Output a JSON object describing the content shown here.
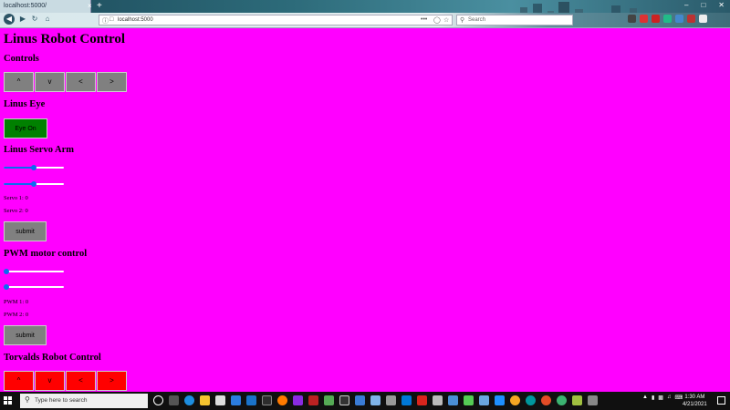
{
  "browser": {
    "tab_title": "localhost:5000/",
    "tab_close": "×",
    "new_tab": "+",
    "url": "localhost:5000",
    "search_placeholder": "Search",
    "menu_dots": "•••",
    "win_min": "–",
    "win_max": "□",
    "win_close": "✕"
  },
  "page": {
    "title": "Linus Robot Control",
    "controls_heading": "Controls",
    "controls_buttons": [
      "^",
      "v",
      "<",
      ">"
    ],
    "eye_heading": "Linus Eye",
    "eye_button": "Eye On",
    "servo_heading": "Linus Servo Arm",
    "servo1_value": 0.5,
    "servo2_value": 0.5,
    "servo1_label": "Servo 1: 0",
    "servo2_label": "Servo 2: 0",
    "servo_submit": "submit",
    "pwm_heading": "PWM motor control",
    "pwm1_value": 0,
    "pwm2_value": 0,
    "pwm1_label": "PWM 1: 0",
    "pwm2_label": "PWM 2: 0",
    "pwm_submit": "submit",
    "torvalds_heading": "Torvalds Robot Control",
    "torvalds_buttons": [
      "^",
      "v",
      "<",
      ">"
    ]
  },
  "taskbar": {
    "search_placeholder": "Type here to search",
    "time": "1:30 AM",
    "date": "4/21/2021"
  },
  "colors": {
    "page_bg": "#ff00ff",
    "grey_button": "#808080",
    "eye_button": "#008000",
    "red_button": "#ff0000",
    "slider_accent": "#0a6cf0"
  }
}
